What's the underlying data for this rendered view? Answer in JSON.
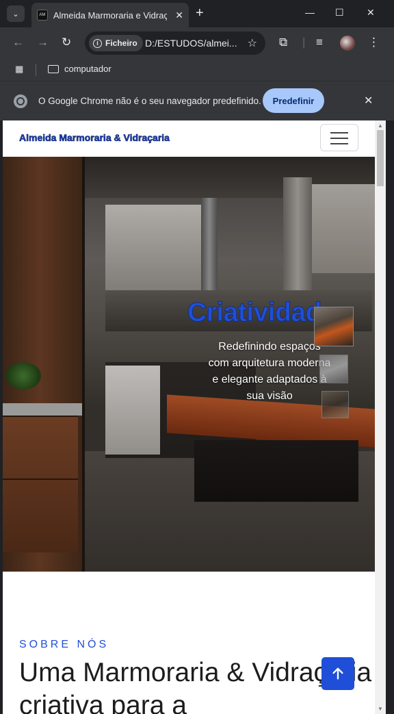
{
  "browser": {
    "tab_title": "Almeida Marmoraria e Vidraçaria",
    "tab_favicon_text": "AM",
    "address_chip": "Ficheiro",
    "address_url": "D:/ESTUDOS/almei...",
    "bookmark_folder": "computador",
    "infobar_text": "O Google Chrome não é o seu navegador predefinido.",
    "infobar_button": "Predefinir"
  },
  "site": {
    "brand": "Almeida Marmoraria & Vidraçaria",
    "hero": {
      "title": "Criatividade",
      "subtitle": "Redefinindo espaços com arquitetura moderna e elegante adaptados à sua visão"
    },
    "about": {
      "label": "SOBRE NÓS",
      "title": "Uma Marmoraria & Vidraçaria criativa para a"
    }
  },
  "colors": {
    "accent": "#1f4fd8",
    "chrome_dark": "#202124",
    "chrome_toolbar": "#35363a",
    "infobar_button": "#a8c7fa"
  },
  "icons": [
    "tab-search-icon",
    "close-icon",
    "plus-icon",
    "minimize-icon",
    "maximize-icon",
    "back-icon",
    "forward-icon",
    "reload-icon",
    "info-icon",
    "star-icon",
    "extensions-icon",
    "media-icon",
    "profile-avatar",
    "menu-dots-icon",
    "apps-icon",
    "folder-icon",
    "chrome-icon",
    "hamburger-icon",
    "arrow-up-icon"
  ]
}
